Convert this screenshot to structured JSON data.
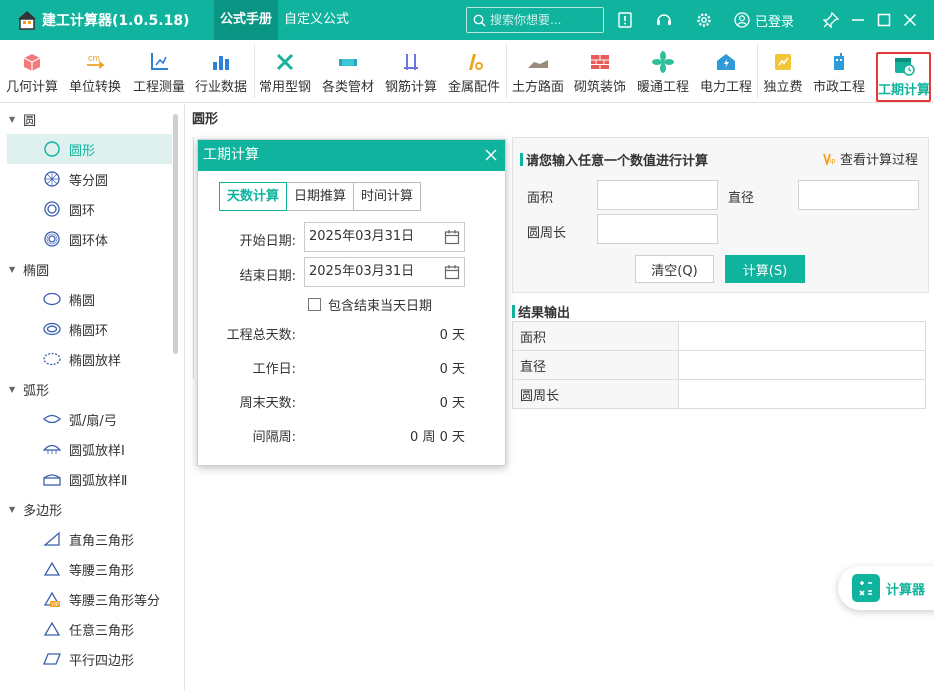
{
  "titlebar": {
    "app_title": "建工计算器(1.0.5.18)",
    "menu": [
      {
        "label": "公式手册",
        "active": true
      },
      {
        "label": "自定义公式",
        "active": false
      }
    ],
    "search_placeholder": "搜索你想要...",
    "login_label": "已登录",
    "icons": [
      "app-logo-icon",
      "feedback-icon",
      "headset-icon",
      "gear-icon",
      "user-icon",
      "pin-icon",
      "minimize-icon",
      "maximize-icon",
      "close-icon"
    ]
  },
  "ribbon": {
    "items": [
      {
        "label": "几何计算",
        "icon": "cube-icon"
      },
      {
        "label": "单位转换",
        "icon": "unit-convert-icon"
      },
      {
        "label": "工程测量",
        "icon": "measure-icon"
      },
      {
        "label": "行业数据",
        "icon": "data-chart-icon"
      },
      {
        "label": "常用型钢",
        "icon": "steel-icon"
      },
      {
        "label": "各类管材",
        "icon": "pipe-icon"
      },
      {
        "label": "钢筋计算",
        "icon": "rebar-icon"
      },
      {
        "label": "金属配件",
        "icon": "metal-part-icon"
      },
      {
        "label": "土方路面",
        "icon": "earthwork-icon"
      },
      {
        "label": "砌筑装饰",
        "icon": "brick-icon"
      },
      {
        "label": "暖通工程",
        "icon": "fan-icon"
      },
      {
        "label": "电力工程",
        "icon": "power-icon"
      },
      {
        "label": "独立费",
        "icon": "fee-icon"
      },
      {
        "label": "市政工程",
        "icon": "municipal-icon"
      },
      {
        "label": "工期计算",
        "icon": "calendar-clock-icon",
        "selected": true
      }
    ]
  },
  "sidebar": {
    "groups": [
      {
        "label": "圆",
        "items": [
          "圆形",
          "等分圆",
          "圆环",
          "圆环体"
        ]
      },
      {
        "label": "椭圆",
        "items": [
          "椭圆",
          "椭圆环",
          "椭圆放样"
        ]
      },
      {
        "label": "弧形",
        "items": [
          "弧/扇/弓",
          "圆弧放样Ⅰ",
          "圆弧放样Ⅱ"
        ]
      },
      {
        "label": "多边形",
        "items": [
          "直角三角形",
          "等腰三角形",
          "等腰三角形等分",
          "任意三角形",
          "平行四边形"
        ]
      }
    ],
    "active_item": "圆形"
  },
  "content": {
    "title": "圆形",
    "input_panel": {
      "heading": "请您输入任意一个数值进行计算",
      "view_process": "查看计算过程",
      "fields": [
        {
          "label": "面积",
          "value": ""
        },
        {
          "label": "直径",
          "value": ""
        },
        {
          "label": "圆周长",
          "value": ""
        }
      ],
      "clear_button": "清空(Q)",
      "calc_button": "计算(S)"
    },
    "result": {
      "heading": "结果输出",
      "rows": [
        {
          "label": "面积",
          "value": ""
        },
        {
          "label": "直径",
          "value": ""
        },
        {
          "label": "圆周长",
          "value": ""
        }
      ]
    }
  },
  "dialog": {
    "title": "工期计算",
    "tabs": [
      {
        "label": "天数计算",
        "active": true
      },
      {
        "label": "日期推算",
        "active": false
      },
      {
        "label": "时间计算",
        "active": false
      }
    ],
    "start_label": "开始日期:",
    "start_value": "2025年03月31日",
    "end_label": "结束日期:",
    "end_value": "2025年03月31日",
    "include_end_label": "包含结束当天日期",
    "include_end_checked": false,
    "stats": [
      {
        "label": "工程总天数:",
        "value": "0 天"
      },
      {
        "label": "工作日:",
        "value": "0 天"
      },
      {
        "label": "周末天数:",
        "value": "0 天"
      },
      {
        "label": "间隔周:",
        "value": "0 周 0 天"
      }
    ]
  },
  "float_button": {
    "label": "计算器"
  },
  "colors": {
    "accent": "#0fb39e",
    "accent_dark": "#0a9483",
    "highlight_border": "#e53935"
  }
}
